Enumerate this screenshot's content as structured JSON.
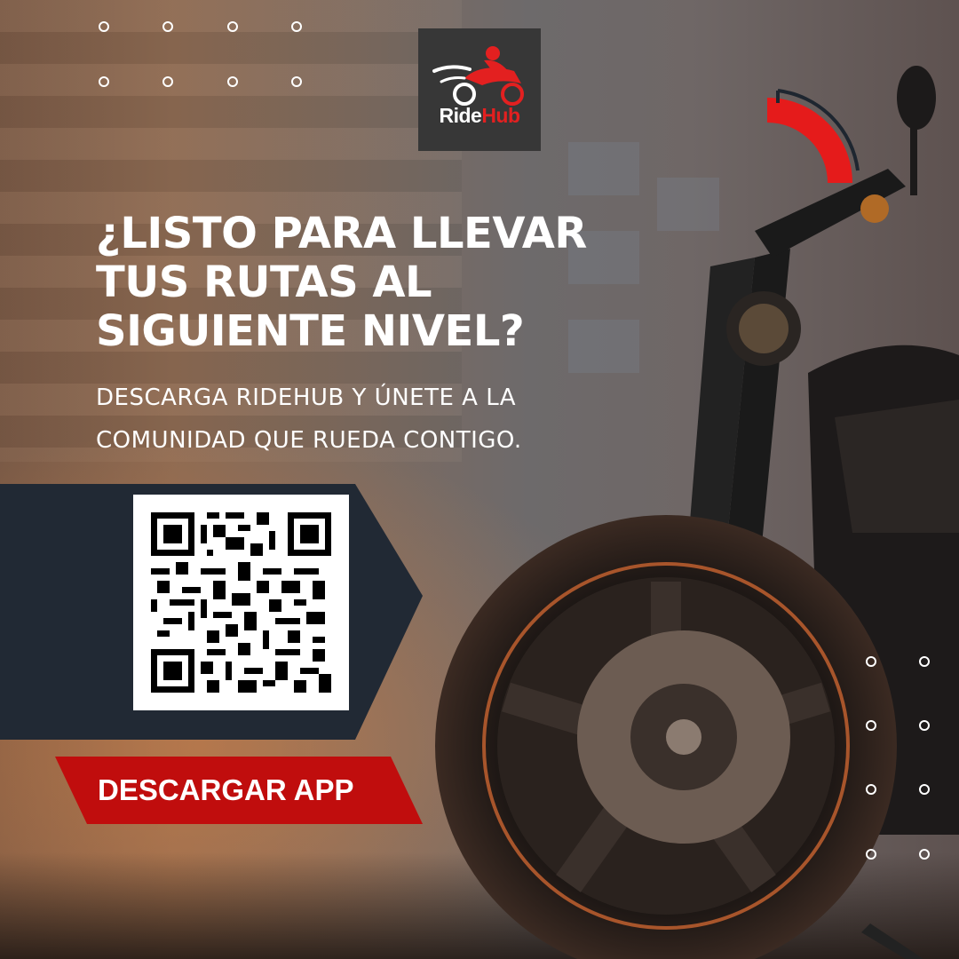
{
  "brand": {
    "name_part1": "Ride",
    "name_part2": "Hub",
    "logo_bg": "#373737",
    "accent": "#e32020"
  },
  "headline": {
    "lines": [
      "¿LISTO PARA LLEVAR",
      "TUS RUTAS AL",
      "SIGUIENTE NIVEL?"
    ]
  },
  "subheadline": {
    "lines": [
      "DESCARGA RIDEHUB Y ÚNETE A LA",
      "COMUNIDAD QUE RUEDA CONTIGO."
    ]
  },
  "qr": {
    "icon": "qr-code-icon"
  },
  "cta": {
    "label": "DESCARGAR APP",
    "color": "#c00d0d"
  },
  "banner": {
    "color": "#212934"
  },
  "decor": {
    "dots_icon": "dot-grid-icon",
    "arc_icon": "corner-arc-icon",
    "motorcycle_icon": "motorcycle-photo"
  }
}
